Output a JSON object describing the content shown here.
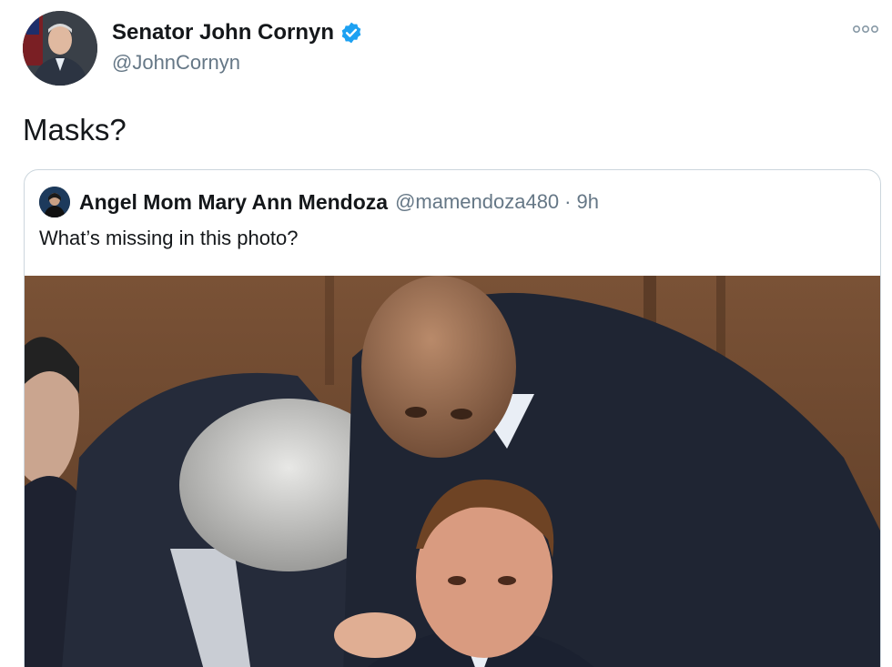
{
  "author": {
    "display_name": "Senator John Cornyn",
    "handle": "@JohnCornyn",
    "verified": true
  },
  "tweet": {
    "text": "Masks?"
  },
  "quoted_tweet": {
    "display_name": "Angel Mom Mary Ann Mendoza",
    "handle": "@mamendoza480",
    "separator": "·",
    "time": "9h",
    "text": "What’s missing in this photo?"
  },
  "icons": {
    "verified": "verified-badge-icon",
    "more": "more-options-icon"
  },
  "colors": {
    "verified_blue": "#1da1f2",
    "secondary_text": "#657786",
    "border": "#ccd6dd"
  }
}
